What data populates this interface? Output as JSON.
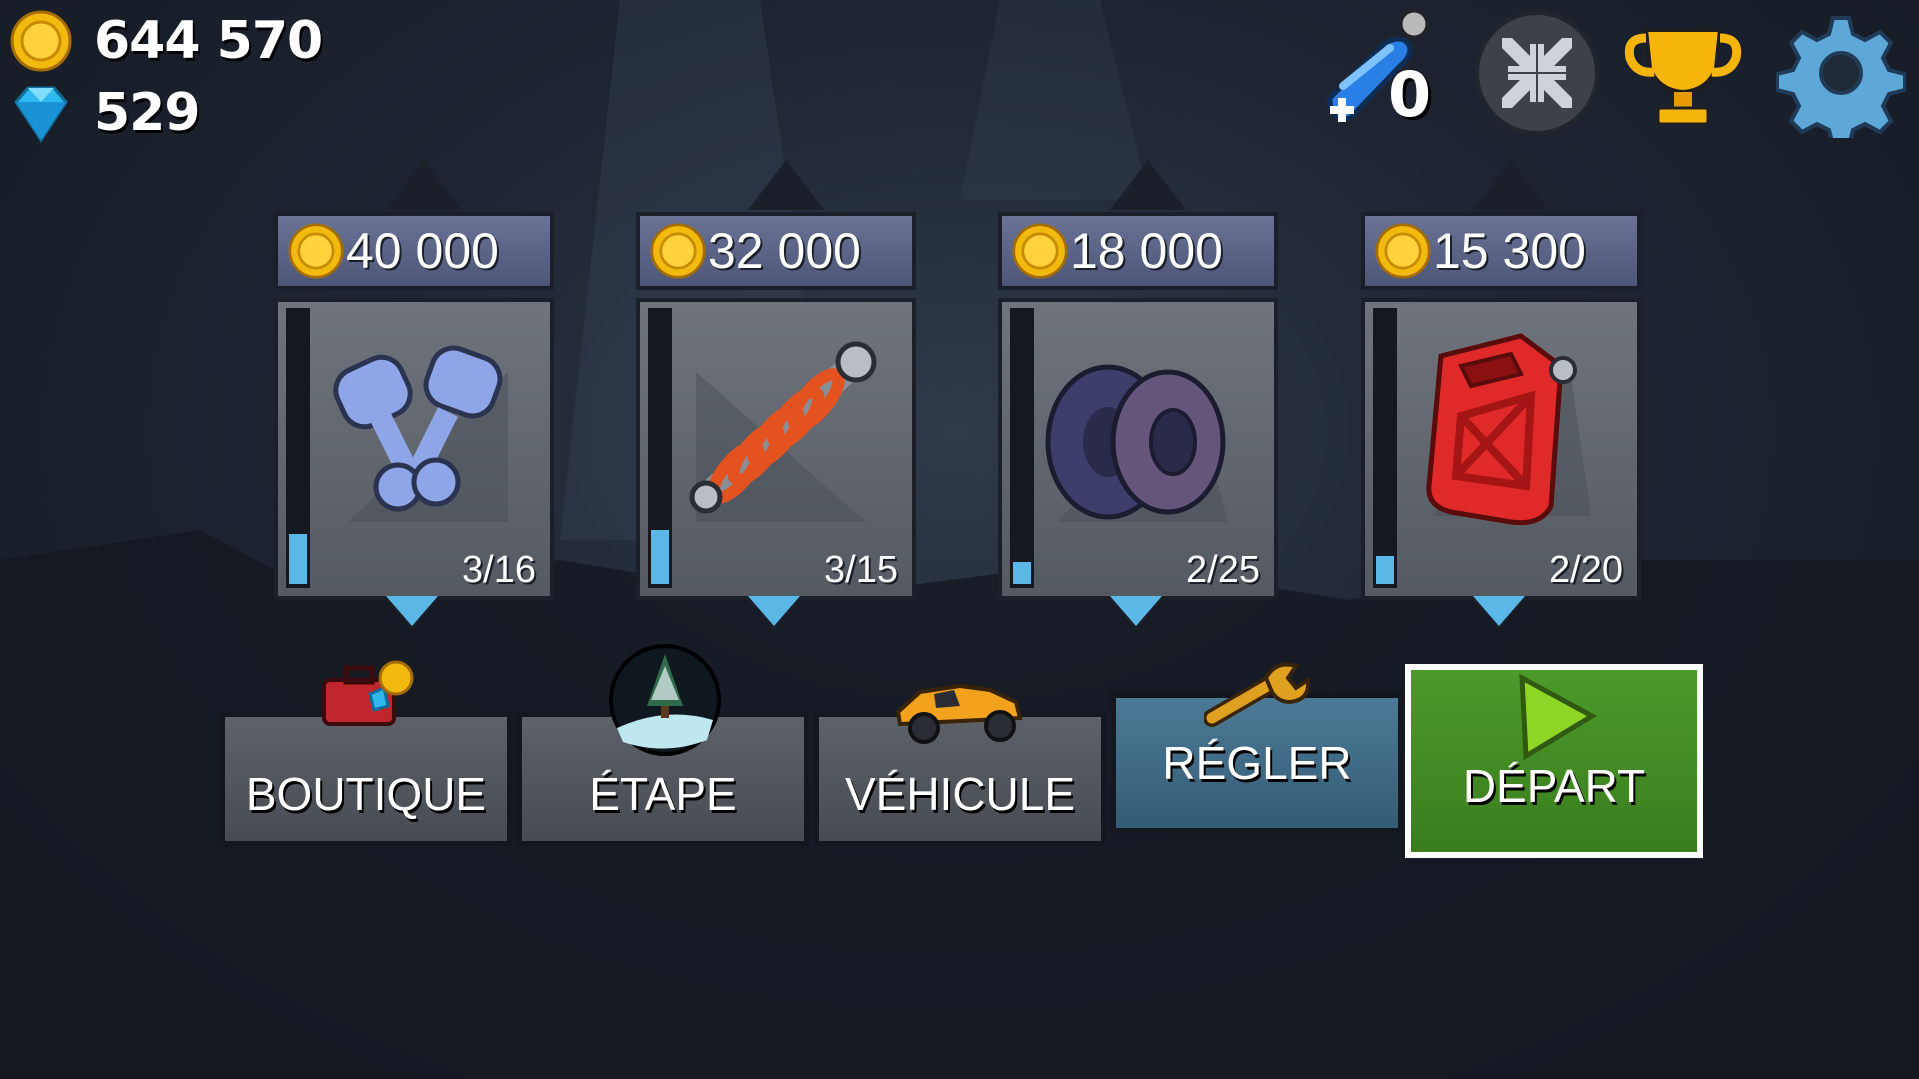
{
  "hud": {
    "coins": "644 570",
    "gems": "529",
    "boost_count": "0",
    "icons": [
      "coin-icon",
      "gem-icon",
      "boost-icon",
      "minimize-icon",
      "trophy-icon",
      "gear-icon"
    ]
  },
  "upgrades": [
    {
      "item": "engine",
      "price": "40 000",
      "level": "3/16",
      "progress": 0.1875
    },
    {
      "item": "suspension",
      "price": "32 000",
      "level": "3/15",
      "progress": 0.2
    },
    {
      "item": "tires",
      "price": "18 000",
      "level": "2/25",
      "progress": 0.08
    },
    {
      "item": "fuel",
      "price": "15 300",
      "level": "2/20",
      "progress": 0.1
    }
  ],
  "menu": {
    "shop": "BOUTIQUE",
    "stage": "ÉTAPE",
    "vehicle": "VÉHICULE",
    "tune": "RÉGLER",
    "start": "DÉPART"
  },
  "colors": {
    "accent_green": "#3a7d1f",
    "active_blue": "#345b75",
    "price_bar": "#5a6386",
    "coin": "#f2b90f",
    "meter_fill": "#5bb8e6"
  }
}
